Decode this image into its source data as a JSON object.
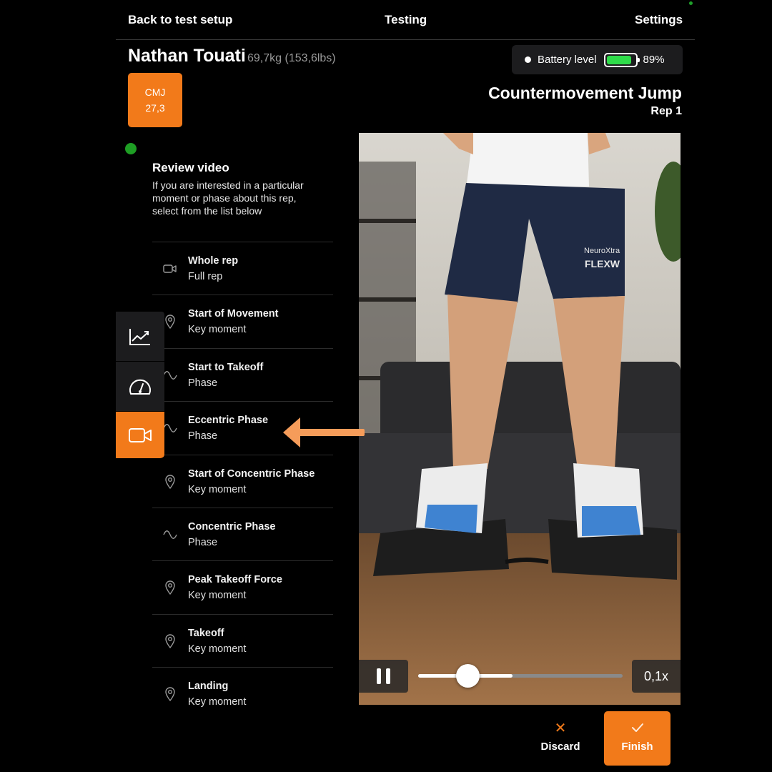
{
  "nav": {
    "back_label": "Back to test setup",
    "center_label": "Testing",
    "settings_label": "Settings"
  },
  "athlete": {
    "name": "Nathan Touati",
    "weight": "69,7kg (153,6lbs)"
  },
  "battery": {
    "label": "Battery level",
    "percent_text": "89%",
    "level": 0.89,
    "fill_color": "#2fdc4a"
  },
  "badge": {
    "code": "CMJ",
    "value": "27,3"
  },
  "test": {
    "title": "Countermovement Jump",
    "rep": "Rep 1"
  },
  "review": {
    "title": "Review video",
    "description_lines": [
      "If you are interested in a particular",
      "moment or phase about this rep,",
      "select from the list below"
    ]
  },
  "list": [
    {
      "title": "Whole rep",
      "subtitle": "Full rep",
      "icon": "video-camera-icon"
    },
    {
      "title": "Start of Movement",
      "subtitle": "Key moment",
      "icon": "location-pin-icon"
    },
    {
      "title": "Start to Takeoff",
      "subtitle": "Phase",
      "icon": "wave-icon"
    },
    {
      "title": "Eccentric Phase",
      "subtitle": "Phase",
      "icon": "wave-icon"
    },
    {
      "title": "Start of Concentric Phase",
      "subtitle": "Key moment",
      "icon": "location-pin-icon"
    },
    {
      "title": "Concentric Phase",
      "subtitle": "Phase",
      "icon": "wave-icon"
    },
    {
      "title": "Peak Takeoff Force",
      "subtitle": "Key moment",
      "icon": "location-pin-icon"
    },
    {
      "title": "Takeoff",
      "subtitle": "Key moment",
      "icon": "location-pin-icon"
    },
    {
      "title": "Landing",
      "subtitle": "Key moment",
      "icon": "location-pin-icon"
    }
  ],
  "side_tabs": [
    {
      "icon": "chart-trend-icon",
      "active": false
    },
    {
      "icon": "gauge-icon",
      "active": false
    },
    {
      "icon": "video-camera-icon",
      "active": true
    }
  ],
  "video": {
    "progress": 0.46,
    "speed": "0,1x",
    "shorts_logo_text_1": "NeuroXtra",
    "shorts_logo_text_2": "FLEXW"
  },
  "actions": {
    "discard_label": "Discard",
    "finish_label": "Finish"
  },
  "colors": {
    "accent": "#f27a1a",
    "status_green": "#1e9e24",
    "background": "#000000",
    "panel": "#1c1c1e"
  }
}
